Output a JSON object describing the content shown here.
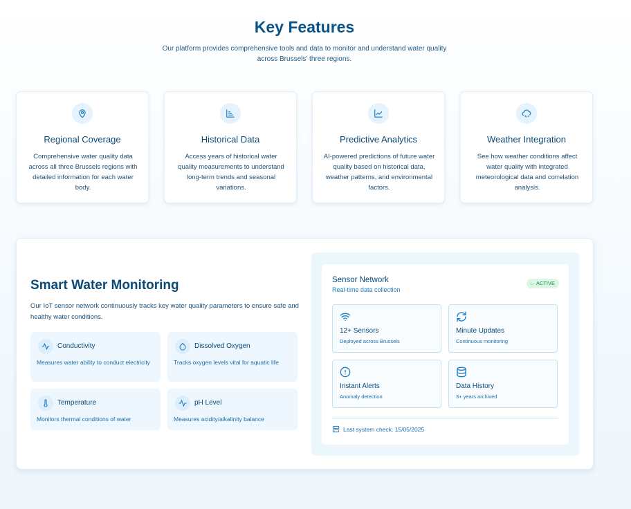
{
  "header": {
    "title": "Key Features",
    "subtitle": "Our platform provides comprehensive tools and data to monitor and understand water quality across Brussels' three regions."
  },
  "features": [
    {
      "icon": "map-pin-icon",
      "title": "Regional Coverage",
      "desc": "Comprehensive water quality data across all three Brussels regions with detailed information for each water body."
    },
    {
      "icon": "bar-list-icon",
      "title": "Historical Data",
      "desc": "Access years of historical water quality measurements to understand long-term trends and seasonal variations."
    },
    {
      "icon": "line-chart-icon",
      "title": "Predictive Analytics",
      "desc": "AI-powered predictions of future water quality based on historical data, weather patterns, and environmental factors."
    },
    {
      "icon": "cloud-rain-icon",
      "title": "Weather Integration",
      "desc": "See how weather conditions affect water quality with integrated meteorological data and correlation analysis."
    }
  ],
  "monitoring": {
    "title": "Smart Water Monitoring",
    "desc": "Our IoT sensor network continuously tracks key water quality parameters to ensure safe and healthy water conditions.",
    "params": [
      {
        "icon": "activity-icon",
        "title": "Conductivity",
        "desc": "Measures water ability to conduct electricity"
      },
      {
        "icon": "droplet-icon",
        "title": "Dissolved Oxygen",
        "desc": "Tracks oxygen levels vital for aquatic life"
      },
      {
        "icon": "thermometer-icon",
        "title": "Temperature",
        "desc": "Monitors thermal conditions of water"
      },
      {
        "icon": "activity-icon",
        "title": "pH Level",
        "desc": "Measures acidity/alkalinity balance"
      }
    ]
  },
  "sensor": {
    "title": "Sensor Network",
    "subtitle": "Real-time data collection",
    "status": "ACTIVE",
    "stats": [
      {
        "icon": "wifi-icon",
        "title": "12+ Sensors",
        "sub": "Deployed across Brussels"
      },
      {
        "icon": "refresh-icon",
        "title": "Minute Updates",
        "sub": "Continuous monitoring"
      },
      {
        "icon": "alert-circle-icon",
        "title": "Instant Alerts",
        "sub": "Anomaly detection"
      },
      {
        "icon": "database-icon",
        "title": "Data History",
        "sub": "3+ years archived"
      }
    ],
    "last_check": "Last system check: 15/05/2025"
  },
  "colors": {
    "primary": "#0b4a78",
    "accent": "#1d7cc0",
    "icon_bg": "#e4f3fd",
    "active_bg": "#dcf7e6",
    "active_text": "#1c8a4b"
  }
}
